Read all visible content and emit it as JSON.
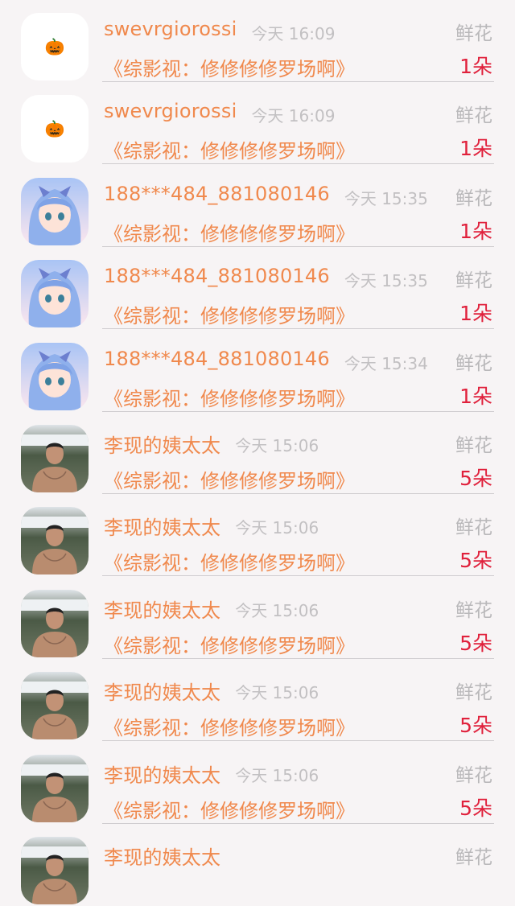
{
  "header": {
    "cut_title": "鲜花"
  },
  "gift_type_label": "鲜花",
  "avatars": {
    "pumpkin": "pumpkin-icon",
    "anime": "anime-girl-avatar",
    "man": "man-photo-avatar"
  },
  "colors": {
    "name": "#f0894d",
    "count": "#e0213c",
    "muted": "#c2c0c2"
  },
  "rows": [
    {
      "avatar": "pumpkin",
      "name": "swevrgiorossi",
      "time": "今天 16:09",
      "gift": "鲜花",
      "title": "《综影视：修修修修罗场啊》",
      "count": "1朵"
    },
    {
      "avatar": "pumpkin",
      "name": "swevrgiorossi",
      "time": "今天 16:09",
      "gift": "鲜花",
      "title": "《综影视：修修修修罗场啊》",
      "count": "1朵"
    },
    {
      "avatar": "anime",
      "name": "188***484_881080146",
      "time": "今天 15:35",
      "gift": "鲜花",
      "title": "《综影视：修修修修罗场啊》",
      "count": "1朵"
    },
    {
      "avatar": "anime",
      "name": "188***484_881080146",
      "time": "今天 15:35",
      "gift": "鲜花",
      "title": "《综影视：修修修修罗场啊》",
      "count": "1朵"
    },
    {
      "avatar": "anime",
      "name": "188***484_881080146",
      "time": "今天 15:34",
      "gift": "鲜花",
      "title": "《综影视：修修修修罗场啊》",
      "count": "1朵"
    },
    {
      "avatar": "man",
      "name": "李现的姨太太",
      "time": "今天 15:06",
      "gift": "鲜花",
      "title": "《综影视：修修修修罗场啊》",
      "count": "5朵"
    },
    {
      "avatar": "man",
      "name": "李现的姨太太",
      "time": "今天 15:06",
      "gift": "鲜花",
      "title": "《综影视：修修修修罗场啊》",
      "count": "5朵"
    },
    {
      "avatar": "man",
      "name": "李现的姨太太",
      "time": "今天 15:06",
      "gift": "鲜花",
      "title": "《综影视：修修修修罗场啊》",
      "count": "5朵"
    },
    {
      "avatar": "man",
      "name": "李现的姨太太",
      "time": "今天 15:06",
      "gift": "鲜花",
      "title": "《综影视：修修修修罗场啊》",
      "count": "5朵"
    },
    {
      "avatar": "man",
      "name": "李现的姨太太",
      "time": "今天 15:06",
      "gift": "鲜花",
      "title": "《综影视：修修修修罗场啊》",
      "count": "5朵"
    },
    {
      "avatar": "man",
      "name": "李现的姨太太",
      "time": "",
      "gift": "鲜花",
      "title": "",
      "count": ""
    }
  ]
}
